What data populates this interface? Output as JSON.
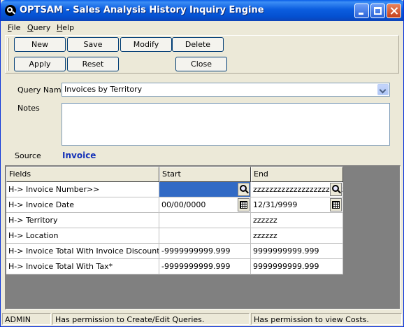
{
  "window": {
    "title": "OPTSAM - Sales Analysis History Inquiry Engine"
  },
  "menu": {
    "items": [
      {
        "label_first": "F",
        "label_rest": "ile"
      },
      {
        "label_first": "Q",
        "label_rest": "uery"
      },
      {
        "label_first": "H",
        "label_rest": "elp"
      }
    ]
  },
  "toolbar": {
    "new_label": "New",
    "save_label": "Save",
    "modify_label": "Modify",
    "delete_label": "Delete",
    "apply_label": "Apply",
    "reset_label": "Reset",
    "close_label": "Close"
  },
  "form": {
    "query_name_label": "Query Name",
    "query_name_value": "Invoices by Territory",
    "notes_label": "Notes",
    "notes_value": "",
    "source_label": "Source",
    "source_value": "Invoice"
  },
  "grid": {
    "columns": [
      "Fields",
      "Start",
      "End"
    ],
    "rows": [
      {
        "field": "H-> Invoice Number>>",
        "start": "",
        "end": "zzzzzzzzzzzzzzzzzzzzzzz"
      },
      {
        "field": "H-> Invoice Date",
        "start": "00/00/0000",
        "end": "12/31/9999"
      },
      {
        "field": "H-> Territory",
        "start": "",
        "end": "zzzzzz"
      },
      {
        "field": "H-> Location",
        "start": "",
        "end": "zzzzzz"
      },
      {
        "field": "H-> Invoice Total With Invoice Discount*",
        "start": "-9999999999.999",
        "end": "9999999999.999"
      },
      {
        "field": "H-> Invoice Total With Tax*",
        "start": "-9999999999.999",
        "end": "9999999999.999"
      }
    ]
  },
  "status": {
    "user": "ADMIN",
    "query_permission": "Has permission to Create/Edit Queries.",
    "cost_permission": "Has permission to view Costs."
  },
  "colors": {
    "source_value": "#1532b8",
    "selected_cell": "#316ac5",
    "title_bar": "#0450d0"
  }
}
